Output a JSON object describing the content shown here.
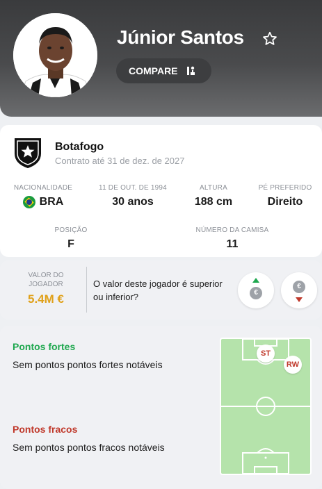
{
  "player": {
    "name": "Júnior Santos",
    "compare_label": "COMPARE"
  },
  "club": {
    "name": "Botafogo",
    "contract": "Contrato até 31 de dez. de 2027"
  },
  "stats": [
    {
      "label": "NACIONALIDADE",
      "value": "BRA",
      "flag": "brazil-flag"
    },
    {
      "label": "11 DE OUT. DE 1994",
      "value": "30 anos"
    },
    {
      "label": "ALTURA",
      "value": "188 cm"
    },
    {
      "label": "PÉ PREFERIDO",
      "value": "Direito"
    },
    {
      "label": "POSIÇÃO",
      "value": "F"
    },
    {
      "label": "NÚMERO DA CAMISA",
      "value": "11"
    }
  ],
  "market_value": {
    "label": "VALOR DO JOGADOR",
    "amount": "5.4M €",
    "question": "O valor deste jogador é superior ou inferior?",
    "coin_symbol": "€"
  },
  "strengths": {
    "title": "Pontos fortes",
    "text": "Sem pontos pontos fortes notáveis"
  },
  "weaknesses": {
    "title": "Pontos fracos",
    "text": "Sem pontos pontos fracos notáveis"
  },
  "positions": [
    "ST",
    "RW"
  ],
  "colors": {
    "strengths": "#1fa84f",
    "weaknesses": "#c0392b",
    "value": "#e0a11a",
    "pitch": "#b5e3ab"
  }
}
